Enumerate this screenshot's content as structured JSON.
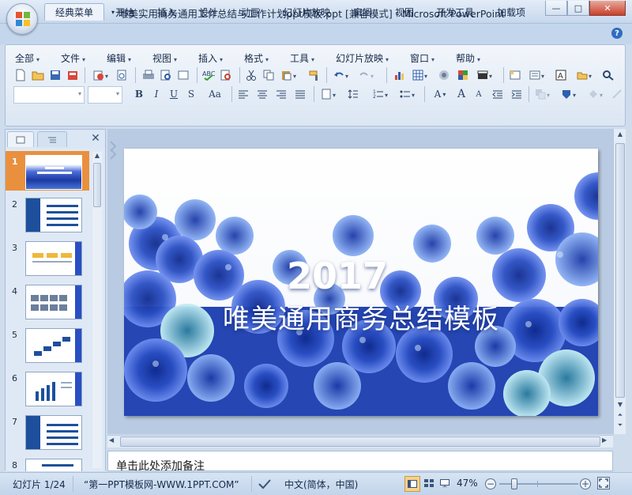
{
  "window": {
    "title": "唯美实用商务通用工作总结与工作计划ppt模板.ppt [兼容模式] - Microsoft PowerPoint",
    "minimize": "—",
    "maximize": "□",
    "close": "✕"
  },
  "quick_access": {
    "save": "💾",
    "undo": "↶",
    "redo": "↻",
    "customize": "▾"
  },
  "tabs": [
    "经典菜单",
    "开始",
    "插入",
    "设计",
    "动画",
    "幻灯片放映",
    "审阅",
    "视图",
    "开发工具",
    "加载项"
  ],
  "help": "?",
  "menus": [
    "全部",
    "文件",
    "编辑",
    "视图",
    "插入",
    "格式",
    "工具",
    "幻灯片放映",
    "窗口",
    "帮助"
  ],
  "format_buttons": [
    "B",
    "I",
    "U",
    "S",
    "Aa"
  ],
  "font_size_buttons": [
    "A",
    "A",
    "A"
  ],
  "slide_panel": {
    "close": "✕",
    "slides": [
      {
        "num": "1",
        "selected": true
      },
      {
        "num": "2"
      },
      {
        "num": "3"
      },
      {
        "num": "4"
      },
      {
        "num": "5"
      },
      {
        "num": "6"
      },
      {
        "num": "7"
      },
      {
        "num": "8"
      }
    ]
  },
  "slide": {
    "year": "2017",
    "title": "唯美通用商务总结模板"
  },
  "notes": {
    "placeholder": "单击此处添加备注"
  },
  "status": {
    "slide_count": "幻灯片 1/24",
    "theme": "“第一PPT模板网-WWW.1PPT.COM”",
    "language": "中文(简体，中国)",
    "zoom": "47%"
  },
  "colors": {
    "accent": "#e3a35b",
    "ribbon": "#dbe6f3",
    "flower_blue": "#2a4fc4"
  }
}
